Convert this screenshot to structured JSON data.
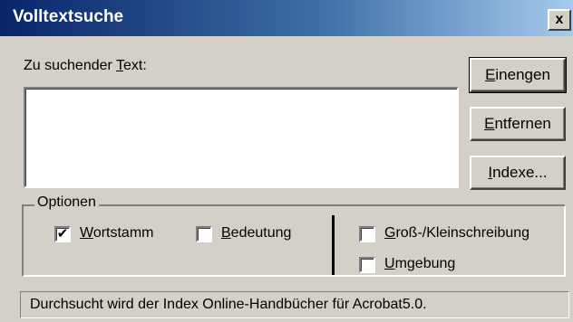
{
  "window": {
    "title": "Volltextsuche",
    "close_label": "x"
  },
  "search": {
    "label_before": "Zu suchender ",
    "label_mnemonic": "T",
    "label_after": "ext:",
    "value": ""
  },
  "buttons": {
    "narrow": {
      "mnemonic": "E",
      "rest": "inengen"
    },
    "remove": {
      "mnemonic": "E",
      "rest": "ntfernen"
    },
    "indexes": {
      "mnemonic": "I",
      "rest": "ndexe..."
    }
  },
  "options": {
    "legend": "Optionen",
    "wordstem": {
      "mnemonic": "W",
      "rest": "ortstamm",
      "checked": true
    },
    "meaning": {
      "mnemonic": "B",
      "rest": "edeutung",
      "checked": false
    },
    "case": {
      "mnemonic": "G",
      "rest": "roß-/Kleinschreibung",
      "checked": false
    },
    "proximity": {
      "mnemonic": "U",
      "rest": "mgebung",
      "checked": false
    },
    "check_mark": "✔"
  },
  "status": {
    "text": "Durchsucht wird der Index Online-Handbücher für Acrobat5.0."
  }
}
